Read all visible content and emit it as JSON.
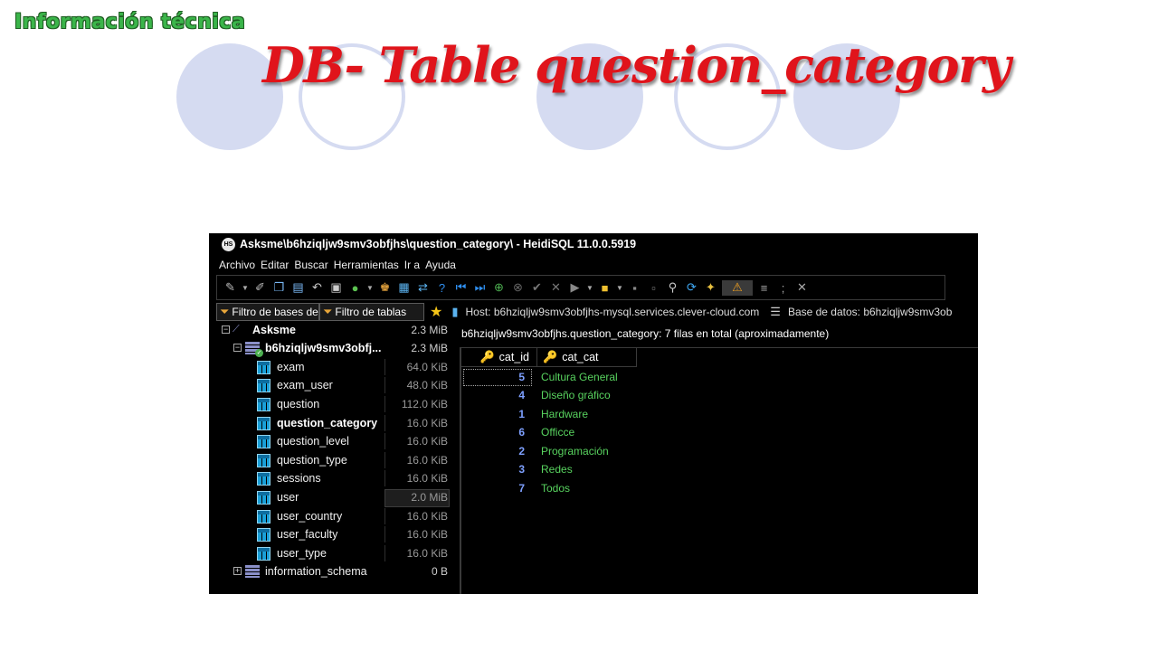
{
  "slide": {
    "brand": "Información técnica",
    "title": "DB- Table question_category"
  },
  "window": {
    "title": "Asksme\\b6hziqljw9smv3obfjhs\\question_category\\ - HeidiSQL 11.0.0.5919",
    "app_icon": "HS"
  },
  "menu": [
    "Archivo",
    "Editar",
    "Buscar",
    "Herramientas",
    "Ir a",
    "Ayuda"
  ],
  "toolbar": {
    "icons": [
      "connect-icon",
      "dropdown-arrow",
      "disconnect-icon",
      "copy-icon",
      "paste-icon",
      "undo-icon",
      "print-icon",
      "refresh-icon",
      "dropdown-arrow",
      "user-manager-icon",
      "export-icon",
      "transfer-icon",
      "help-icon",
      "first-record-icon",
      "last-record-icon",
      "add-record-icon",
      "cancel-record-icon",
      "post-record-icon",
      "delete-record-icon",
      "execute-icon",
      "dropdown-arrow",
      "open-folder-icon",
      "dropdown-arrow",
      "save-icon",
      "save-as-icon",
      "find-icon",
      "replace-icon",
      "clean-icon",
      "warning-binary-icon",
      "wrap-icon",
      "semicolon-icon",
      "close-tab-icon"
    ]
  },
  "filters": {
    "db_filter": "Filtro de bases de",
    "table_filter": "Filtro de tablas"
  },
  "host_bar": {
    "host": "Host: b6hziqljw9smv3obfjhs-mysql.services.clever-cloud.com",
    "database": "Base de datos: b6hziqljw9smv3ob"
  },
  "tree": {
    "root": {
      "label": "Asksme",
      "size": "2.3 MiB"
    },
    "database": {
      "label": "b6hziqljw9smv3obfj...",
      "size": "2.3 MiB"
    },
    "tables": [
      {
        "label": "exam",
        "size": "64.0 KiB"
      },
      {
        "label": "exam_user",
        "size": "48.0 KiB"
      },
      {
        "label": "question",
        "size": "112.0 KiB"
      },
      {
        "label": "question_category",
        "size": "16.0 KiB"
      },
      {
        "label": "question_level",
        "size": "16.0 KiB"
      },
      {
        "label": "question_type",
        "size": "16.0 KiB"
      },
      {
        "label": "sessions",
        "size": "16.0 KiB"
      },
      {
        "label": "user",
        "size": "2.0 MiB"
      },
      {
        "label": "user_country",
        "size": "16.0 KiB"
      },
      {
        "label": "user_faculty",
        "size": "16.0 KiB"
      },
      {
        "label": "user_type",
        "size": "16.0 KiB"
      }
    ],
    "schema": {
      "label": "information_schema",
      "size": "0 B"
    }
  },
  "grid": {
    "caption": "b6hziqljw9smv3obfjhs.question_category: 7 filas en total (aproximadamente)",
    "columns": [
      "cat_id",
      "cat_cat"
    ],
    "rows": [
      {
        "cat_id": "5",
        "cat_cat": "Cultura General"
      },
      {
        "cat_id": "4",
        "cat_cat": "Diseño gráfico"
      },
      {
        "cat_id": "1",
        "cat_cat": "Hardware"
      },
      {
        "cat_id": "6",
        "cat_cat": "Officce"
      },
      {
        "cat_id": "2",
        "cat_cat": "Programación"
      },
      {
        "cat_id": "3",
        "cat_cat": "Redes"
      },
      {
        "cat_id": "7",
        "cat_cat": "Todos"
      }
    ]
  },
  "colors": {
    "title_red": "#e0141b",
    "brand_green": "#3bb54a",
    "circle_blue": "#d5dbf1",
    "id_blue": "#7ea0ff",
    "text_green": "#58d35f"
  }
}
